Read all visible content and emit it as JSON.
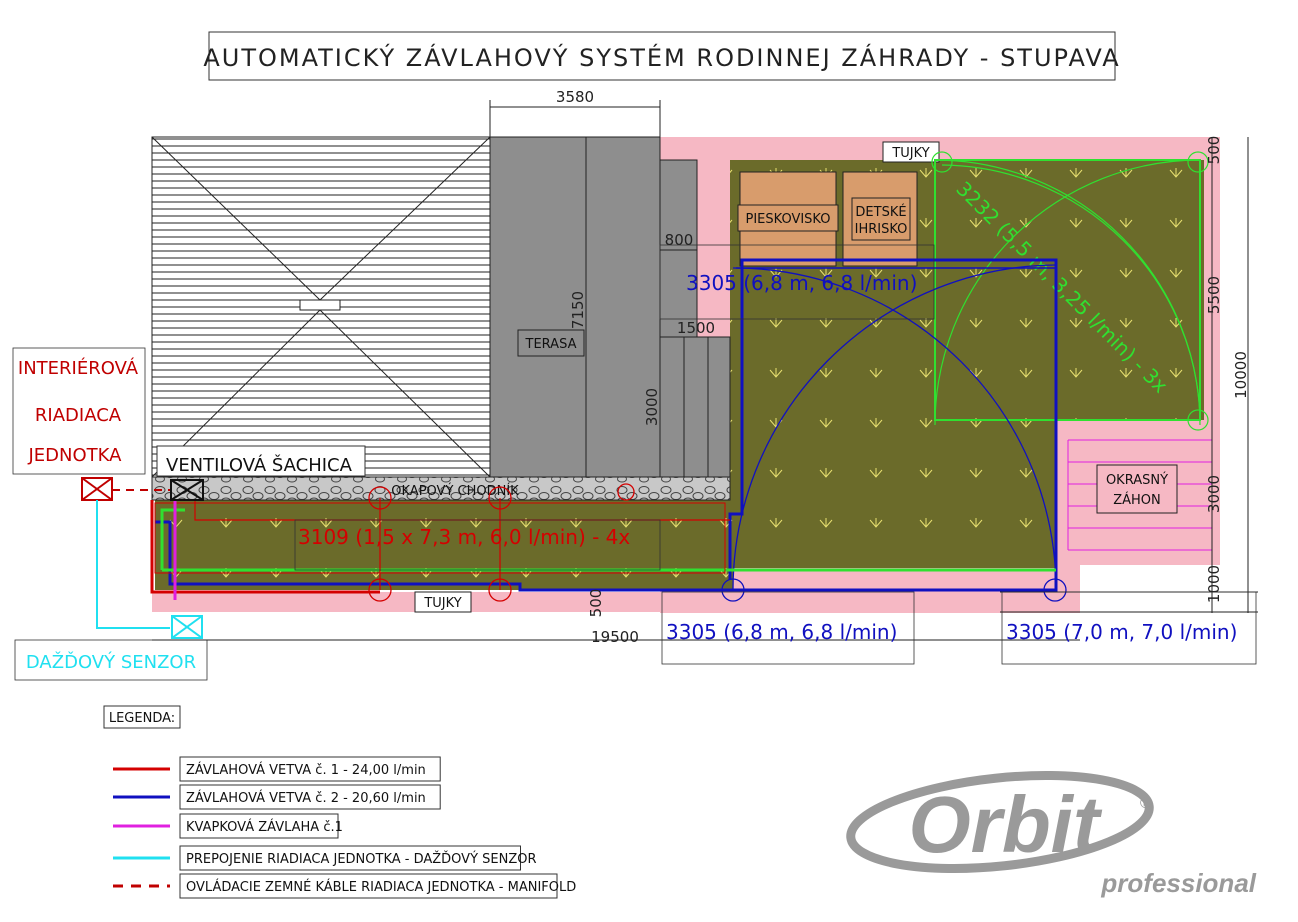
{
  "title": "AUTOMATICKÝ ZÁVLAHOVÝ SYSTÉM RODINNEJ ZÁHRADY - STUPAVA",
  "dimensions": {
    "terrace_width": "3580",
    "terrace_depth": "7150",
    "step_depth": "800",
    "stairs_width": "1500",
    "stairs_length": "3000",
    "total_length": "19500",
    "total_depth": "10000",
    "right_top": "500",
    "right_upper": "5500",
    "right_lower": "3000",
    "right_bottom": "1000",
    "bottom_strip": "500"
  },
  "labels": {
    "tujky_top": "TUJKY",
    "tujky_bottom": "TUJKY",
    "pieskovisko": "PIESKOVISKO",
    "detske_1": "DETSKÉ",
    "detske_2": "IHRISKO",
    "terasa": "TERASA",
    "okrasny_1": "OKRASNÝ",
    "okrasny_2": "ZÁHON",
    "okapovy": "OKAPOVÝ CHODNÍK",
    "ventilova": "VENTILOVÁ ŠACHICA",
    "interierova_1": "INTERIÉROVÁ",
    "interierova_2": "RIADIACA",
    "interierova_3": "JEDNOTKA",
    "dazdovy": "DAŽĎOVÝ SENZOR"
  },
  "sprinklers": {
    "green": "3232 (5,5 m, 3,25 l/min) - 3x",
    "blue_upper": "3305 (6,8 m, 6,8 l/min)",
    "blue_lower": "3305 (6,8 m, 6,8 l/min)",
    "blue_right": "3305 (7,0 m, 7,0 l/min)",
    "red": "3109 (1,5 x 7,3 m, 6,0 l/min) - 4x"
  },
  "legend": {
    "title": "LEGENDA:",
    "items": [
      {
        "label": "ZÁVLAHOVÁ VETVA č. 1 - 24,00 l/min",
        "color": "#d40000",
        "style": "solid"
      },
      {
        "label": "ZÁVLAHOVÁ VETVA č. 2 - 20,60 l/min",
        "color": "#1010c0",
        "style": "solid"
      },
      {
        "label": "KVAPKOVÁ ZÁVLAHA č.1",
        "color": "#e020e0",
        "style": "solid"
      },
      {
        "label": "PREPOJENIE RIADIACA JEDNOTKA - DAŽĎOVÝ SENZOR",
        "color": "#20e0f0",
        "style": "solid"
      },
      {
        "label": "OVLÁDACIE ZEMNÉ KÁBLE RIADIACA JEDNOTKA - MANIFOLD",
        "color": "#c00000",
        "style": "dashed"
      }
    ]
  },
  "logo": {
    "brand": "Orbit",
    "registered": "®",
    "sub": "professional"
  },
  "colors": {
    "lawn": "#6b6b2a",
    "border": "#f6b8c4",
    "terrace": "#8e8e8e",
    "sandbox": "#d89c6c",
    "red_branch": "#d40000",
    "blue_branch": "#1010c0",
    "green_sprinkler": "#30e030",
    "drip": "#e020e0",
    "sensor_link": "#20e0f0"
  }
}
